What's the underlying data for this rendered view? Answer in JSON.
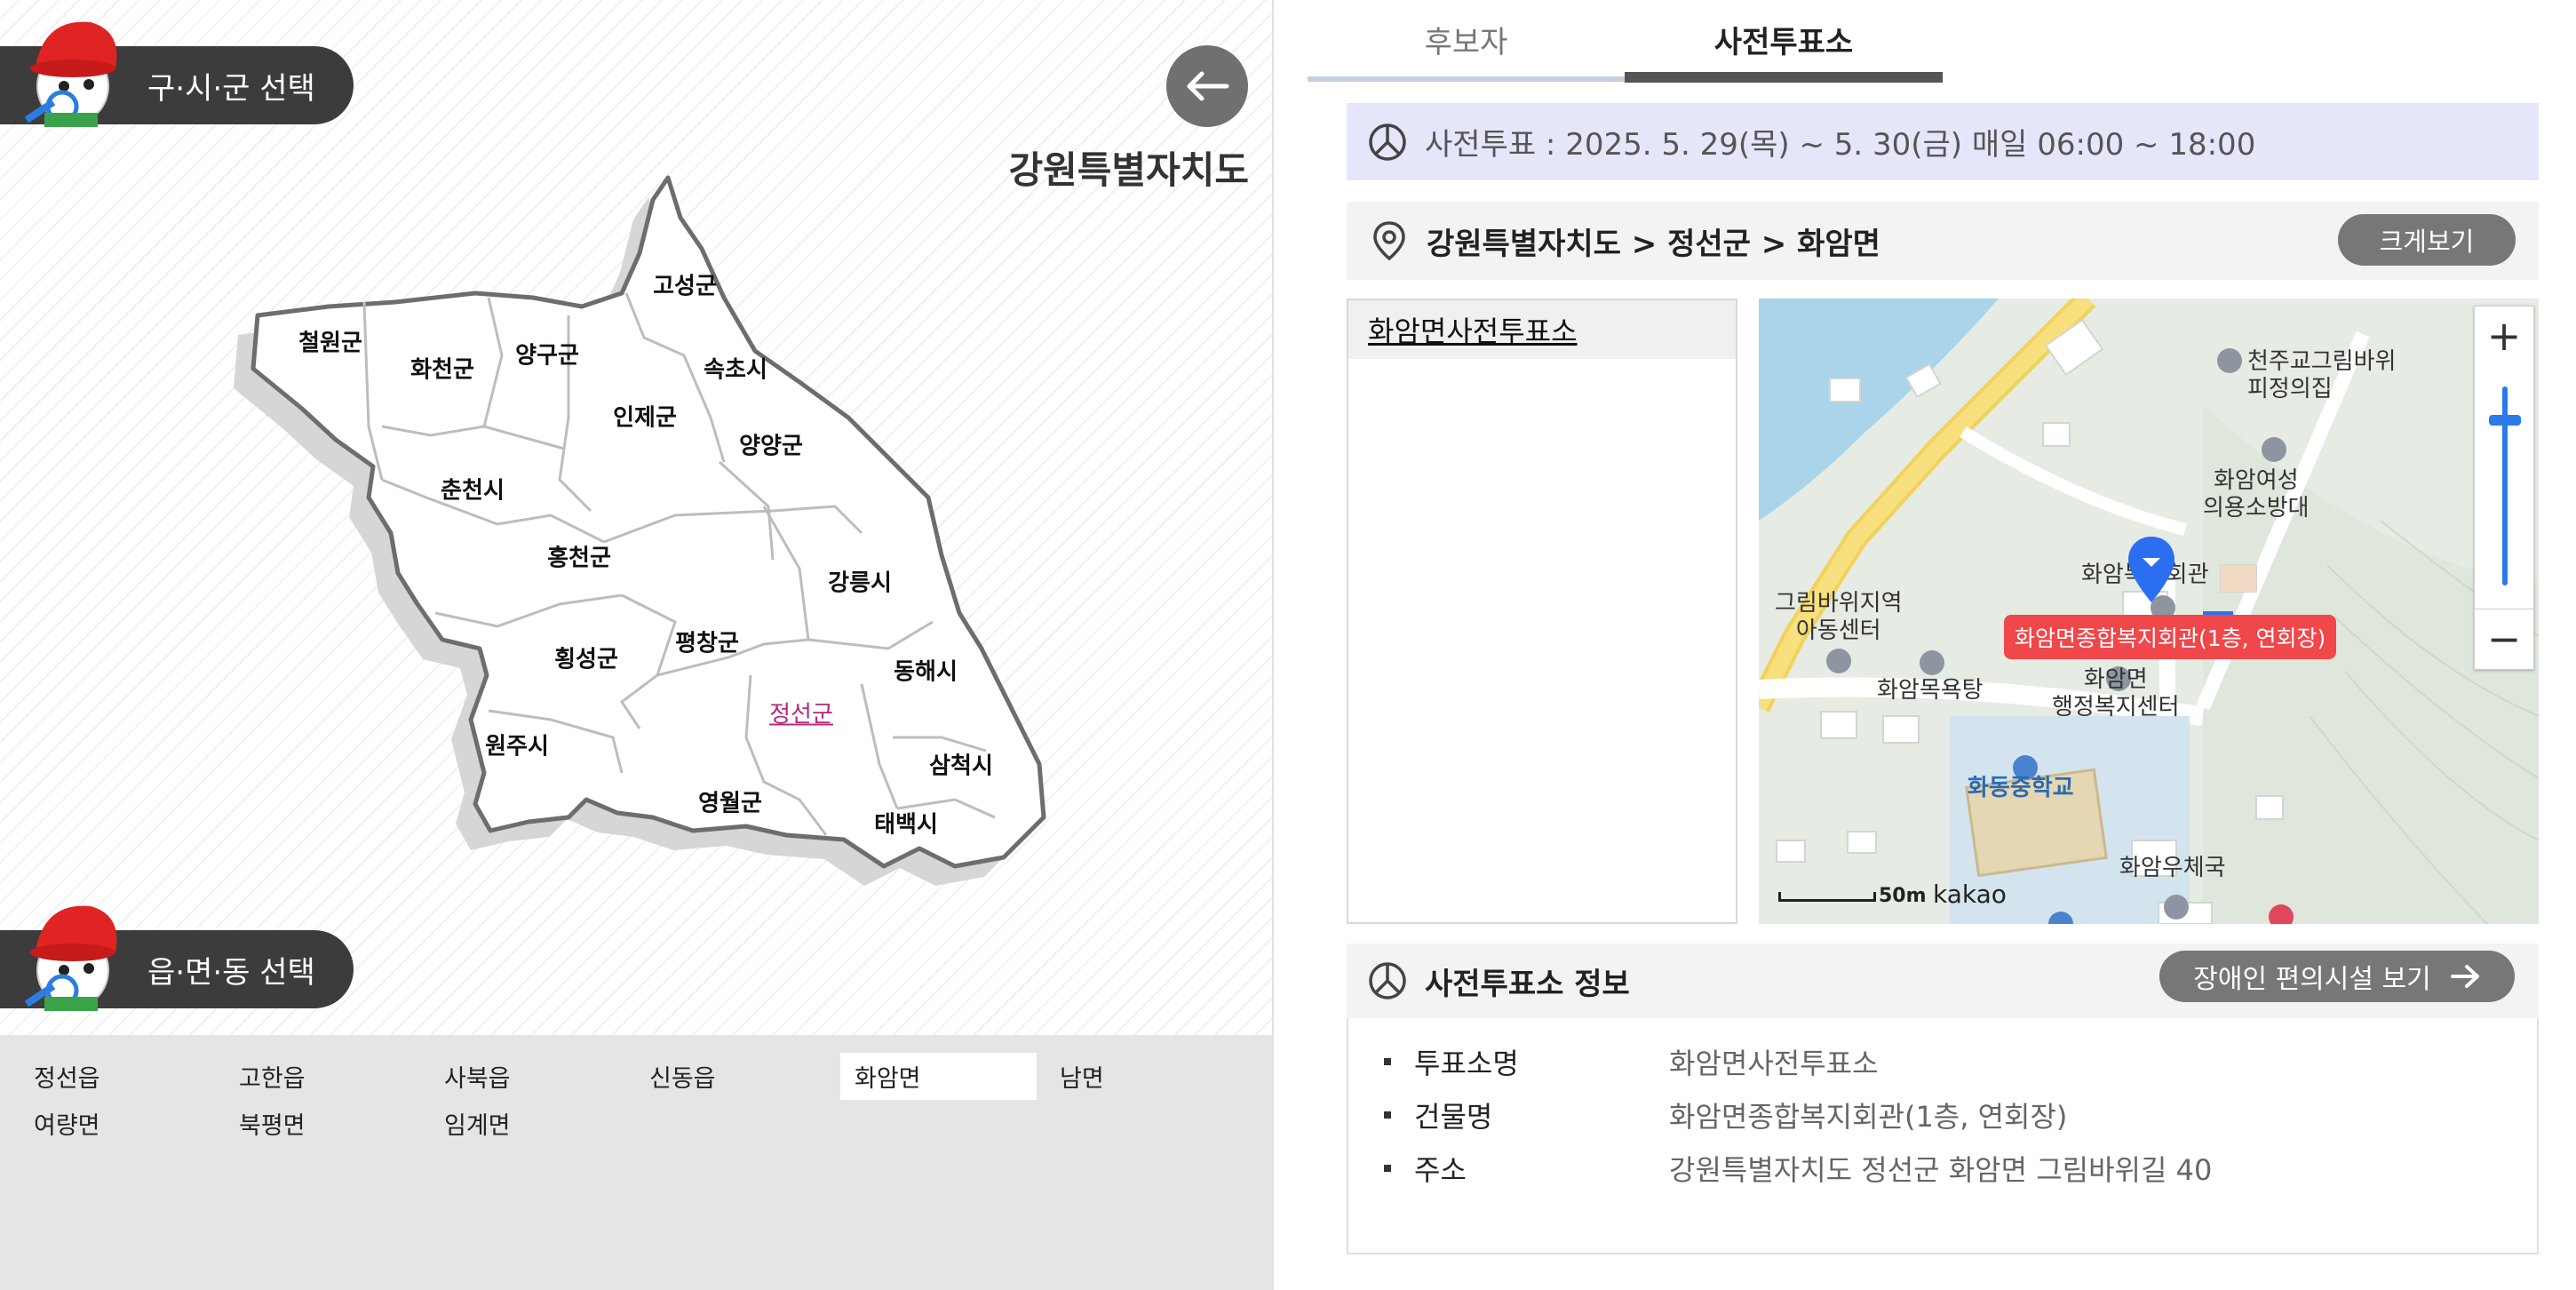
{
  "left": {
    "region_select_label": "구·시·군 선택",
    "town_select_label": "읍·면·동 선택",
    "province_title": "강원특별자치도",
    "districts": [
      "고성군",
      "철원군",
      "화천군",
      "양구군",
      "속초시",
      "인제군",
      "양양군",
      "춘천시",
      "홍천군",
      "강릉시",
      "횡성군",
      "평창군",
      "동해시",
      "정선군",
      "원주시",
      "삼척시",
      "영월군",
      "태백시"
    ],
    "towns": [
      "정선읍",
      "고한읍",
      "사북읍",
      "신동읍",
      "화암면",
      "남면",
      "여량면",
      "북평면",
      "임계면"
    ],
    "selected_district": "정선군",
    "selected_town": "화암면"
  },
  "tabs": [
    {
      "label": "후보자",
      "active": false
    },
    {
      "label": "사전투표소",
      "active": true
    }
  ],
  "period": "사전투표 : 2025. 5. 29(목) ~ 5. 30(금) 매일 06:00 ~ 18:00",
  "location_path": "강원특별자치도 > 정선군 > 화암면",
  "view_larger_button": "크게보기",
  "place_list": [
    "화암면사전투표소"
  ],
  "map": {
    "labels": {
      "church": "천주교그림바위\n피정의집",
      "fire": "화암여성\n의용소방대",
      "hall": "화암복지회관",
      "child": "그림바위지역\n아동센터",
      "bath": "화암목욕탕",
      "admin": "화암면\n행정복지센터",
      "school": "화동중학교",
      "post": "화암우체국"
    },
    "marker_label": "화암면종합복지회관(1층, 연회장)",
    "scale_label": "50m",
    "brand": "kakao",
    "zoom_in": "+",
    "zoom_out": "−",
    "zoom_level_fraction": 0.15
  },
  "info": {
    "title": "사전투표소 정보",
    "accessibility_button": "장애인 편의시설 보기",
    "rows": [
      {
        "key": "투표소명",
        "value": "화암면사전투표소"
      },
      {
        "key": "건물명",
        "value": "화암면종합복지회관(1층, 연회장)"
      },
      {
        "key": "주소",
        "value": "강원특별자치도 정선군 화암면 그림바위길 40"
      }
    ]
  },
  "colors": {
    "active_district": "#b4287f",
    "period_bg": "#e6e6fb",
    "marker": "#2b6ff0",
    "marker_label_bg": "#f0474a"
  }
}
